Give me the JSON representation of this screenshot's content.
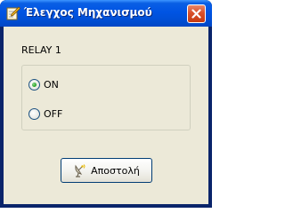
{
  "window": {
    "title": "Έλεγχος Μηχανισμού",
    "icon": "edit-checklist-icon",
    "close_icon": "close-icon"
  },
  "relay": {
    "label": "RELAY 1",
    "options": [
      {
        "label": "ON",
        "selected": true
      },
      {
        "label": "OFF",
        "selected": false
      }
    ]
  },
  "actions": {
    "send_label": "Αποστολή",
    "send_icon": "satellite-dish-icon"
  },
  "colors": {
    "titlebar": "#0054e3",
    "client_bg": "#ece9d8",
    "close_button": "#d8502a",
    "radio_selected": "#21a121"
  }
}
